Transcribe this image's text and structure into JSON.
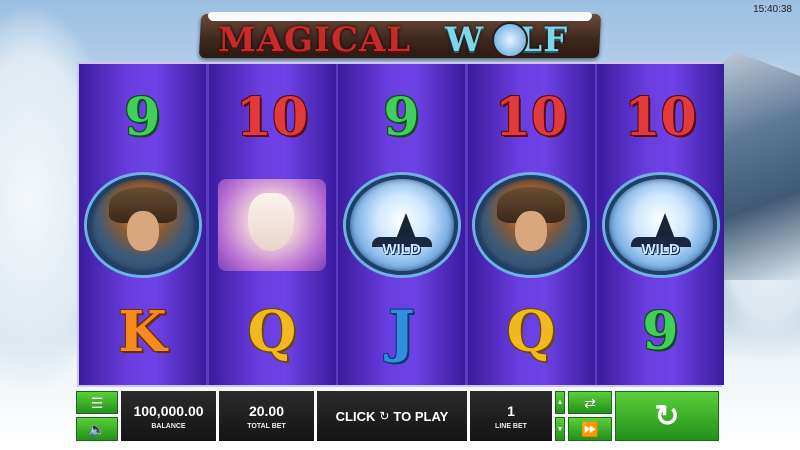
{
  "status": {
    "clock": "15:40:38"
  },
  "logo": {
    "part1": "MAGICAL",
    "part2": "W",
    "part3": "LF"
  },
  "reels": [
    [
      {
        "type": "num",
        "label": "9",
        "cls": "n9"
      },
      {
        "type": "woman"
      },
      {
        "type": "num",
        "label": "K",
        "cls": "nK"
      }
    ],
    [
      {
        "type": "num",
        "label": "10",
        "cls": "n10"
      },
      {
        "type": "wolf"
      },
      {
        "type": "num",
        "label": "Q",
        "cls": "nQ"
      }
    ],
    [
      {
        "type": "num",
        "label": "9",
        "cls": "n9"
      },
      {
        "type": "wild",
        "label": "WILD"
      },
      {
        "type": "num",
        "label": "J",
        "cls": "nJ"
      }
    ],
    [
      {
        "type": "num",
        "label": "10",
        "cls": "n10"
      },
      {
        "type": "woman"
      },
      {
        "type": "num",
        "label": "Q",
        "cls": "nQ"
      }
    ],
    [
      {
        "type": "num",
        "label": "10",
        "cls": "n10"
      },
      {
        "type": "wild",
        "label": "WILD"
      },
      {
        "type": "num",
        "label": "9",
        "cls": "n9"
      }
    ]
  ],
  "controls": {
    "menu_icon": "menu-icon",
    "sound_icon": "speaker-icon",
    "balance_value": "100,000.00",
    "balance_label": "BALANCE",
    "total_bet_value": "20.00",
    "total_bet_label": "TOTAL BET",
    "play_prefix": "CLICK",
    "play_suffix": "TO PLAY",
    "line_bet_value": "1",
    "line_bet_label": "LINE BET",
    "autoplay_icon": "autoplay-icon",
    "fast_icon": "fast-forward-icon",
    "spin_icon": "spin-icon"
  },
  "colors": {
    "accent_green": "#34b024",
    "reel_purple": "#6a3de0"
  }
}
